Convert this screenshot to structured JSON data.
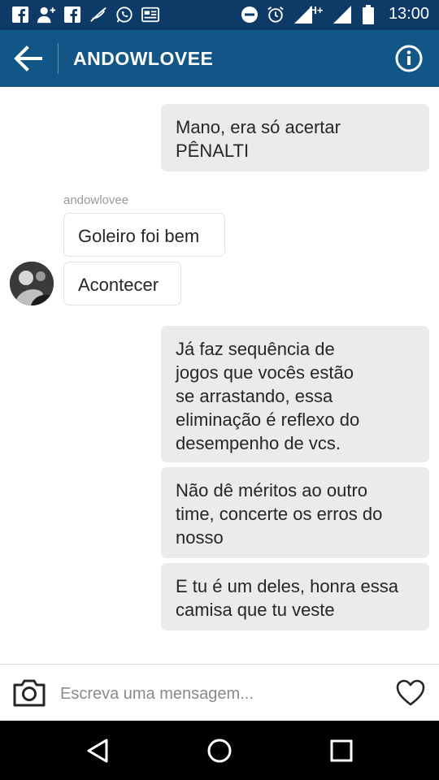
{
  "status_bar": {
    "time": "13:00",
    "network": "H+",
    "notification_icons": [
      "facebook-icon",
      "add-friend-icon",
      "facebook-icon",
      "feather-icon",
      "whatsapp-icon",
      "news-icon"
    ],
    "system_icons": [
      "do-not-disturb-icon",
      "alarm-icon",
      "signal-icon",
      "signal-icon",
      "battery-icon"
    ]
  },
  "header": {
    "title": "ANDOWLOVEE",
    "back_icon": "arrow-left-icon",
    "info_icon": "info-icon"
  },
  "conversation": {
    "sender_name": "andowlovee",
    "messages": [
      {
        "direction": "outgoing",
        "text": "Mano, era só acertar\nPÊNALTI"
      },
      {
        "direction": "incoming",
        "text": "Goleiro foi bem"
      },
      {
        "direction": "incoming",
        "text": "Acontecer"
      },
      {
        "direction": "outgoing",
        "text": "Já faz sequência de\njogos que vocês estão\nse arrastando, essa\neliminação é reflexo do\ndesempenho de vcs."
      },
      {
        "direction": "outgoing",
        "text": "Não dê méritos ao outro\ntime, concerte os erros do\nnosso"
      },
      {
        "direction": "outgoing",
        "text": "E tu é um deles, honra essa\ncamisa que tu veste"
      }
    ]
  },
  "composer": {
    "placeholder": "Escreva uma mensagem...",
    "camera_icon": "camera-icon",
    "like_icon": "heart-icon"
  },
  "nav_bar": {
    "icons": [
      "back-triangle-icon",
      "home-circle-icon",
      "recents-square-icon"
    ]
  },
  "colors": {
    "status_bar": "#0d3a66",
    "app_bar": "#125688",
    "outgoing_bubble": "#ebebeb",
    "incoming_border": "#e2e2e2"
  }
}
